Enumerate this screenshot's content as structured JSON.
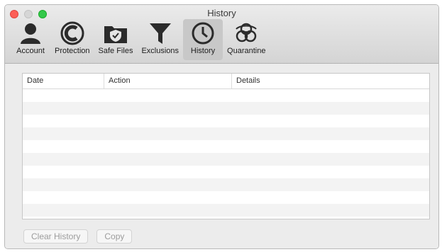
{
  "window": {
    "title": "History"
  },
  "toolbar": {
    "items": [
      {
        "label": "Account",
        "icon": "person-icon"
      },
      {
        "label": "Protection",
        "icon": "protection-icon"
      },
      {
        "label": "Safe Files",
        "icon": "shield-folder-icon"
      },
      {
        "label": "Exclusions",
        "icon": "filter-icon"
      },
      {
        "label": "History",
        "icon": "clock-icon",
        "selected": true
      },
      {
        "label": "Quarantine",
        "icon": "biohazard-icon"
      }
    ]
  },
  "history_table": {
    "columns": [
      "Date",
      "Action",
      "Details"
    ],
    "rows": []
  },
  "actions": {
    "clear_history": "Clear History",
    "copy": "Copy"
  },
  "colors": {
    "close": "#fc5f57",
    "minimize": "#d6d6d6",
    "zoom": "#34c84a",
    "selected_tab": "#c8c8c8"
  }
}
